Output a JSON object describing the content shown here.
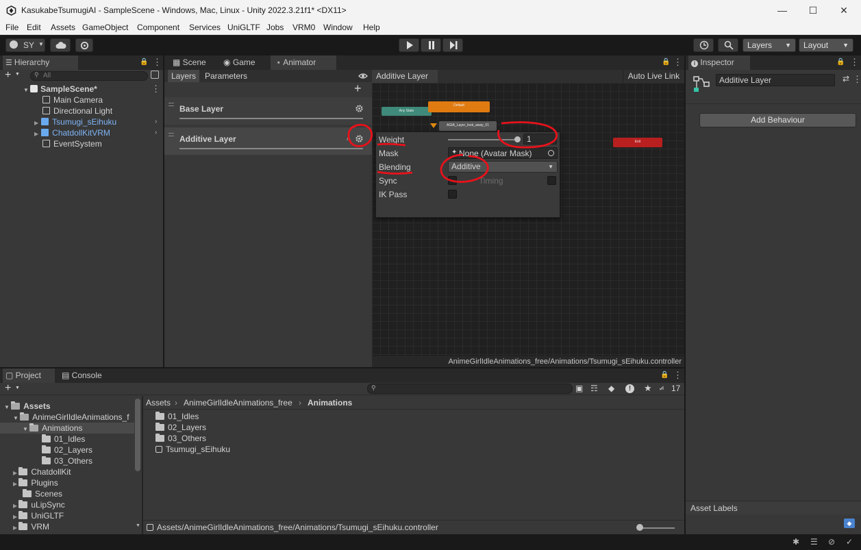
{
  "window": {
    "title": "KasukabeTsumugiAI - SampleScene - Windows, Mac, Linux - Unity 2022.3.21f1* <DX11>"
  },
  "menu": [
    "File",
    "Edit",
    "Assets",
    "GameObject",
    "Component",
    "Services",
    "UniGLTF",
    "Jobs",
    "VRM0",
    "Window",
    "Help"
  ],
  "toolbar": {
    "account": "SY",
    "layers_dropdown": "Layers",
    "layout_dropdown": "Layout"
  },
  "hierarchy": {
    "tab": "Hierarchy",
    "search_placeholder": "All",
    "scene": "SampleScene*",
    "items": [
      "Main Camera",
      "Directional Light",
      "Tsumugi_sEihuku",
      "ChatdollKitVRM",
      "EventSystem"
    ]
  },
  "center_tabs": [
    "Scene",
    "Game",
    "Animator"
  ],
  "animator": {
    "subtabs": [
      "Layers",
      "Parameters"
    ],
    "breadcrumb": "Additive Layer",
    "auto_live_link": "Auto Live Link",
    "layers": [
      "Base Layer",
      "Additive Layer"
    ],
    "nodes": {
      "any_state": "Any State",
      "default": "Default",
      "layer_state": "AGIA_Layer_look_away_01",
      "exit": "Exit"
    },
    "settings": {
      "weight_label": "Weight",
      "weight_value": "1",
      "weight_fraction": 1,
      "mask_label": "Mask",
      "mask_value": "None (Avatar Mask)",
      "blending_label": "Blending",
      "blending_value": "Additive",
      "sync_label": "Sync",
      "timing_label": "Timing",
      "ikpass_label": "IK Pass"
    },
    "path": "AnimeGirlIdleAnimations_free/Animations/Tsumugi_sEihuku.controller"
  },
  "inspector": {
    "tab": "Inspector",
    "name_value": "Additive Layer",
    "add_behaviour": "Add Behaviour",
    "asset_labels": "Asset Labels"
  },
  "project": {
    "tabs": [
      "Project",
      "Console"
    ],
    "hidden_count": "17",
    "tree": {
      "root": "Assets",
      "pack": "AnimeGirlIdleAnimations_f",
      "animations": "Animations",
      "sub": [
        "01_Idles",
        "02_Layers",
        "03_Others"
      ],
      "others": [
        "ChatdollKit",
        "Plugins",
        "Scenes",
        "uLipSync",
        "UniGLTF",
        "VRM"
      ]
    },
    "breadcrumb": [
      "Assets",
      "AnimeGirlIdleAnimations_free",
      "Animations"
    ],
    "files": [
      "01_Idles",
      "02_Layers",
      "03_Others",
      "Tsumugi_sEihuku"
    ],
    "selected_path": "Assets/AnimeGirlIdleAnimations_free/Animations/Tsumugi_sEihuku.controller"
  },
  "colors": {
    "annotation_red": "#e8121b",
    "default_state": "#e07b12",
    "any_state": "#3f8a7a",
    "exit_state": "#b81f1f"
  }
}
